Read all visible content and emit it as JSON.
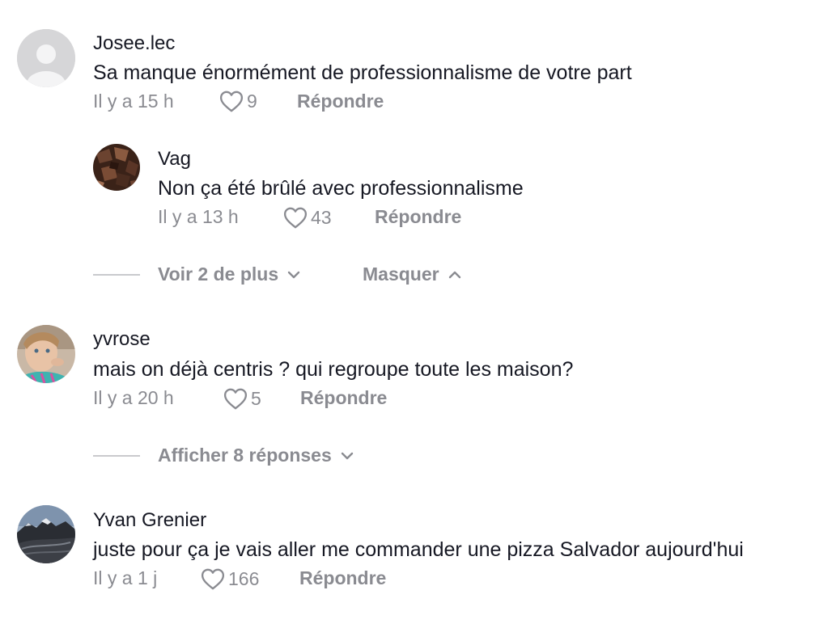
{
  "comments": [
    {
      "username": "Josee.lec",
      "text": "Sa manque énormément de professionnalisme de votre part",
      "time": "Il y a 15 h",
      "likes": "9",
      "reply_label": "Répondre",
      "avatar": "default-avatar"
    },
    {
      "username": "Vag",
      "text": "Non ça été brûlé avec professionnalisme",
      "time": "Il y a 13 h",
      "likes": "43",
      "reply_label": "Répondre",
      "avatar": "chocolate-photo"
    },
    {
      "username": "yvrose",
      "text": "mais on déjà centris ? qui regroupe toute les maison?",
      "time": "Il y a 20 h",
      "likes": "5",
      "reply_label": "Répondre",
      "avatar": "child-photo"
    },
    {
      "username": "Yvan Grenier",
      "text": "juste pour ça je vais aller me commander une pizza Salvador aujourd'hui",
      "time": "Il y a 1 j",
      "likes": "166",
      "reply_label": "Répondre",
      "avatar": "mountain-photo"
    }
  ],
  "thread_1": {
    "more_label": "Voir 2 de plus",
    "hide_label": "Masquer"
  },
  "thread_2": {
    "show_label": "Afficher 8 réponses"
  },
  "colors": {
    "primary_text": "#161823",
    "secondary_text": "#8a8b91",
    "divider": "#c9cacd"
  }
}
